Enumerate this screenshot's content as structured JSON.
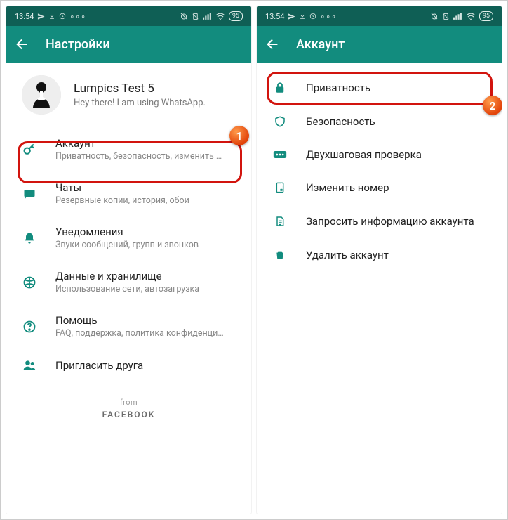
{
  "statusbar": {
    "time": "13:54",
    "battery": "95"
  },
  "left": {
    "title": "Настройки",
    "profile": {
      "name": "Lumpics Test 5",
      "status": "Hey there! I am using WhatsApp."
    },
    "items": [
      {
        "icon": "key",
        "label": "Аккаунт",
        "sub": "Приватность, безопасность, изменить номер"
      },
      {
        "icon": "chat",
        "label": "Чаты",
        "sub": "Резервные копии, история, обои"
      },
      {
        "icon": "bell",
        "label": "Уведомления",
        "sub": "Звуки сообщений, групп и звонков"
      },
      {
        "icon": "data",
        "label": "Данные и хранилище",
        "sub": "Использование сети, автозагрузка"
      },
      {
        "icon": "help",
        "label": "Помощь",
        "sub": "FAQ, поддержка, политика конфиденциальн..."
      },
      {
        "icon": "people",
        "label": "Пригласить друга",
        "sub": ""
      }
    ],
    "footer": {
      "from": "from",
      "brand": "FACEBOOK"
    }
  },
  "right": {
    "title": "Аккаунт",
    "items": [
      {
        "icon": "lock",
        "label": "Приватность"
      },
      {
        "icon": "shield",
        "label": "Безопасность"
      },
      {
        "icon": "dots",
        "label": "Двухшаговая проверка"
      },
      {
        "icon": "sim",
        "label": "Изменить номер"
      },
      {
        "icon": "doc",
        "label": "Запросить информацию аккаунта"
      },
      {
        "icon": "trash",
        "label": "Удалить аккаунт"
      }
    ]
  },
  "steps": {
    "one": "1",
    "two": "2"
  }
}
